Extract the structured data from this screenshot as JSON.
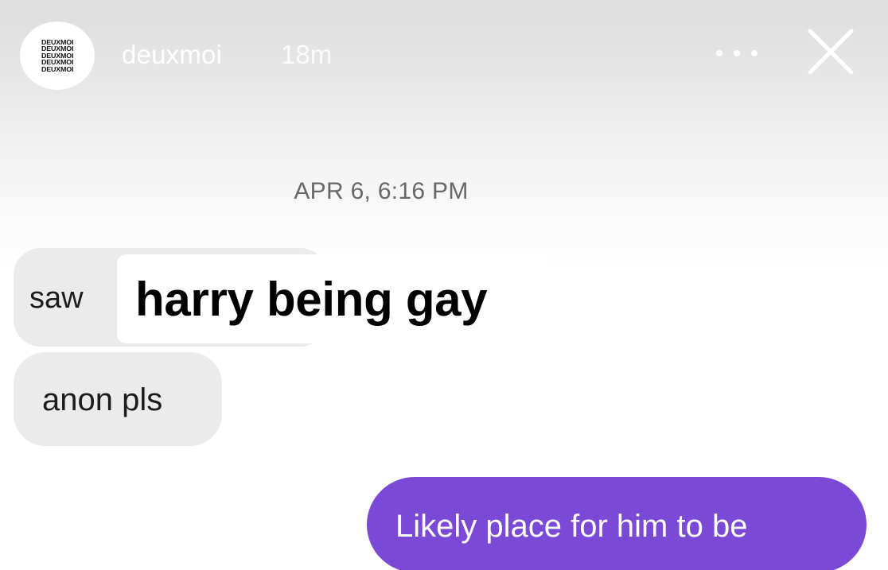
{
  "header": {
    "avatar_lines": [
      "DEUXMOI",
      "DEUXMOI",
      "DEUXMOI",
      "DEUXMOI",
      "DEUXMOI"
    ],
    "username": "deuxmoi",
    "posted_ago": "18m",
    "more_icon": "more-horizontal-icon",
    "close_icon": "close-icon"
  },
  "thread": {
    "timestamp": "APR 6, 6:16 PM",
    "messages": [
      {
        "sender": "them",
        "text": "saw",
        "overlay_text": "harry being gay"
      },
      {
        "sender": "them",
        "text": "anon pls"
      },
      {
        "sender": "me",
        "text": "Likely place for him to be"
      }
    ]
  },
  "colors": {
    "incoming_bubble": "#ebebeb",
    "outgoing_bubble": "#7a4ad6",
    "header_text": "#ffffff",
    "timestamp_text": "#686868"
  }
}
